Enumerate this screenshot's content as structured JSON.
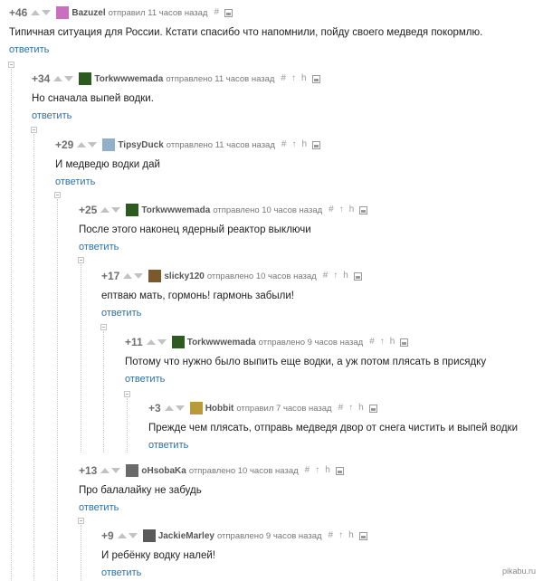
{
  "comments": [
    {
      "rating": "+46",
      "user": "Bazuzel",
      "meta": "отправил 11 часов назад",
      "text": "Типичная ситуация для России. Кстати спасибо что напомнили, пойду своего медведя покормлю.",
      "reply": "ответить",
      "avatar_color": "#c86fbf",
      "hash": "#",
      "arrow": "",
      "branch": ""
    },
    {
      "rating": "+34",
      "user": "Torkwwwemada",
      "meta": "отправлено 11 часов назад",
      "text": "Но сначала выпей водки.",
      "reply": "ответить",
      "avatar_color": "#2d5a1f",
      "hash": "#",
      "arrow": "↑",
      "branch": "h"
    },
    {
      "rating": "+29",
      "user": "TipsyDuck",
      "meta": "отправлено 11 часов назад",
      "text": "И медведю водки дай",
      "reply": "ответить",
      "avatar_color": "#8fb0c8",
      "hash": "#",
      "arrow": "↑",
      "branch": "h"
    },
    {
      "rating": "+25",
      "user": "Torkwwwemada",
      "meta": "отправлено 10 часов назад",
      "text": "После этого наконец ядерный реактор выключи",
      "reply": "ответить",
      "avatar_color": "#2d5a1f",
      "hash": "#",
      "arrow": "↑",
      "branch": "h"
    },
    {
      "rating": "+17",
      "user": "slicky120",
      "meta": "отправлено 10 часов назад",
      "text": "ептваю мать, гормонь! гармонь забыли!",
      "reply": "ответить",
      "avatar_color": "#7a5a2c",
      "hash": "#",
      "arrow": "↑",
      "branch": "h"
    },
    {
      "rating": "+11",
      "user": "Torkwwwemada",
      "meta": "отправлено 9 часов назад",
      "text": "Потому что нужно было выпить еще водки, а уж потом плясать в присядку",
      "reply": "ответить",
      "avatar_color": "#2d5a1f",
      "hash": "#",
      "arrow": "↑",
      "branch": "h"
    },
    {
      "rating": "+3",
      "user": "Hobbit",
      "meta": "отправил 7 часов назад",
      "text": "Прежде чем плясать, отправь медведя двор от снега чистить и выпей водки",
      "reply": "ответить",
      "avatar_color": "#b89a3a",
      "hash": "#",
      "arrow": "↑",
      "branch": "h"
    },
    {
      "rating": "+13",
      "user": "oHsobaKa",
      "meta": "отправлено 10 часов назад",
      "text": "Про балалайку не забудь",
      "reply": "ответить",
      "avatar_color": "#6a6a6a",
      "hash": "#",
      "arrow": "↑",
      "branch": "h"
    },
    {
      "rating": "+9",
      "user": "JackieMarley",
      "meta": "отправлено 9 часов назад",
      "text": "И ребёнку водку налей!",
      "reply": "ответить",
      "avatar_color": "#5a5a5a",
      "hash": "#",
      "arrow": "↑",
      "branch": "h"
    }
  ],
  "watermark": "pikabu.ru"
}
